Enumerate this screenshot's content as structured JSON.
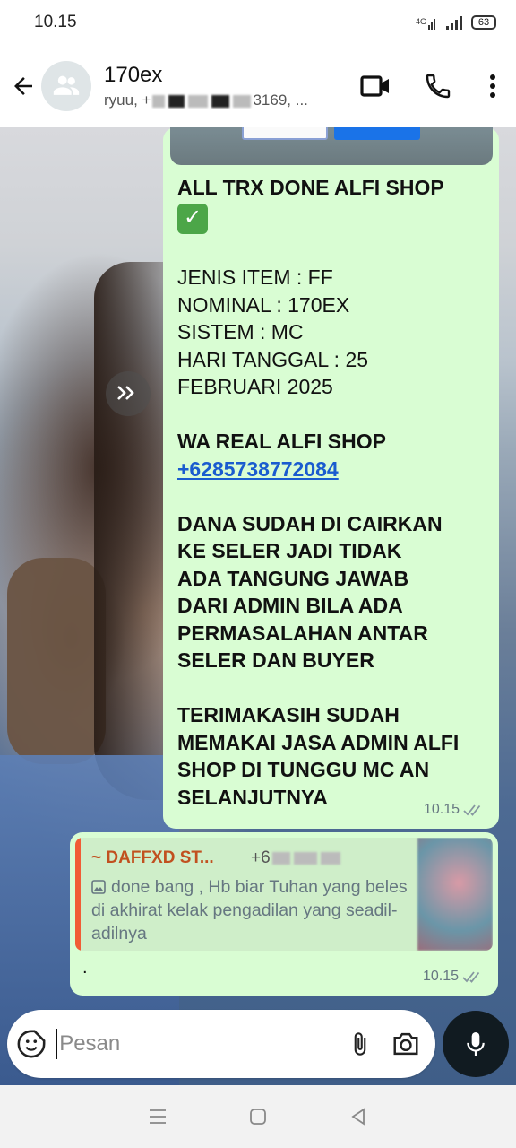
{
  "status_bar": {
    "time": "10.15",
    "network": "4G",
    "battery": "63"
  },
  "header": {
    "title": "170ex",
    "subtitle_start": "ryuu, +",
    "subtitle_end": "3169, ...",
    "icons": [
      "back-arrow-icon",
      "group-avatar-icon",
      "video-call-icon",
      "voice-call-icon",
      "more-vert-icon"
    ]
  },
  "messages": [
    {
      "lines": [
        "ALL TRX DONE  ALFI SHOP",
        "",
        "JENIS ITEM : FF",
        "NOMINAL : 170EX",
        "SISTEM : MC",
        "HARI TANGGAL : 25",
        "FEBRUARI 2025",
        "",
        "WA REAL ALFI SHOP",
        "+6285738772084",
        "",
        "DANA SUDAH DI CAIRKAN",
        "KE SELER JADI TIDAK",
        "ADA TANGUNG JAWAB",
        "DARI ADMIN BILA ADA",
        "PERMASALAHAN ANTAR",
        "SELER DAN BUYER",
        "",
        "TERIMAKASIH SUDAH",
        "MEMAKAI JASA ADMIN ALFI",
        "SHOP DI TUNGGU MC AN",
        "SELANJUTNYA"
      ],
      "check_emoji": "✓",
      "time": "10.15"
    },
    {
      "quote": {
        "author": "~ DAFFXD ST...",
        "phone": "+6",
        "text": "done bang , Hb biar Tuhan yang beles di akhirat kelak pengadilan yang seadil-adilnya"
      },
      "text": ".",
      "time": "10.15"
    }
  ],
  "composer": {
    "placeholder": "Pesan"
  },
  "nav": {
    "icons": [
      "menu-icon",
      "home-icon",
      "back-icon"
    ]
  }
}
